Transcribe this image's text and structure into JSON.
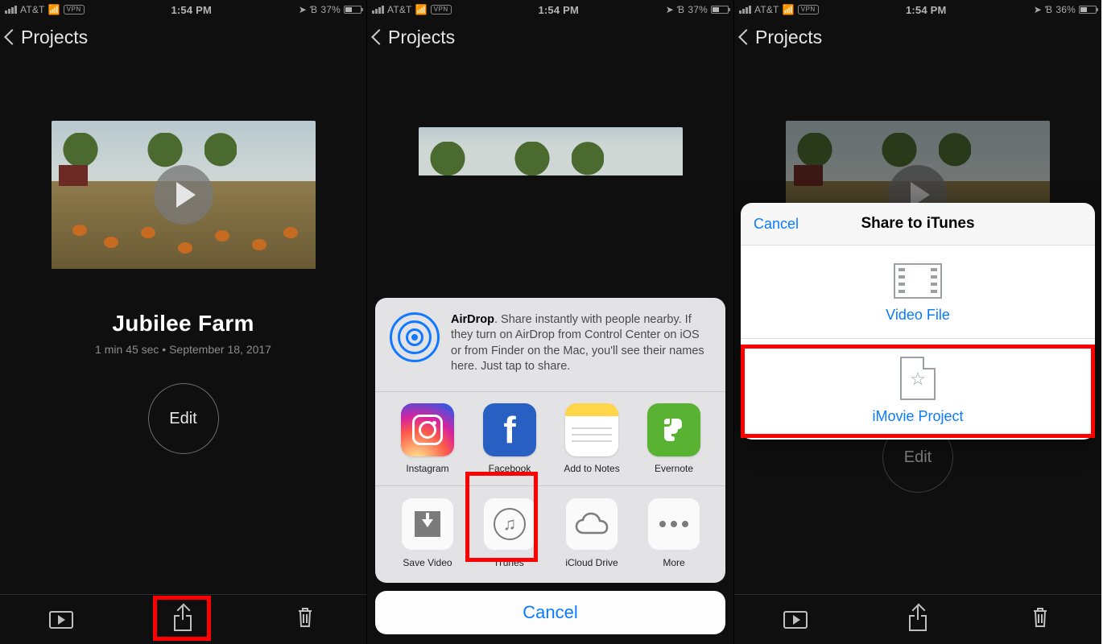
{
  "status": {
    "carrier": "AT&T",
    "vpn": "VPN",
    "time": "1:54 PM",
    "battery1": "37%",
    "battery2": "37%",
    "battery3": "36%"
  },
  "nav": {
    "back_label": "Projects"
  },
  "project": {
    "title": "Jubilee Farm",
    "duration": "1 min 45 sec",
    "date": "September 18, 2017",
    "edit_label": "Edit"
  },
  "share_sheet": {
    "airdrop_title": "AirDrop",
    "airdrop_desc": ". Share instantly with people nearby. If they turn on AirDrop from Control Center on iOS or from Finder on the Mac, you'll see their names here. Just tap to share.",
    "apps": [
      "Instagram",
      "Facebook",
      "Add to Notes",
      "Evernote"
    ],
    "actions": [
      "Save Video",
      "iTunes",
      "iCloud Drive",
      "More"
    ],
    "cancel": "Cancel"
  },
  "itunes_sheet": {
    "cancel": "Cancel",
    "title": "Share to iTunes",
    "opt_video": "Video File",
    "opt_project": "iMovie Project"
  }
}
